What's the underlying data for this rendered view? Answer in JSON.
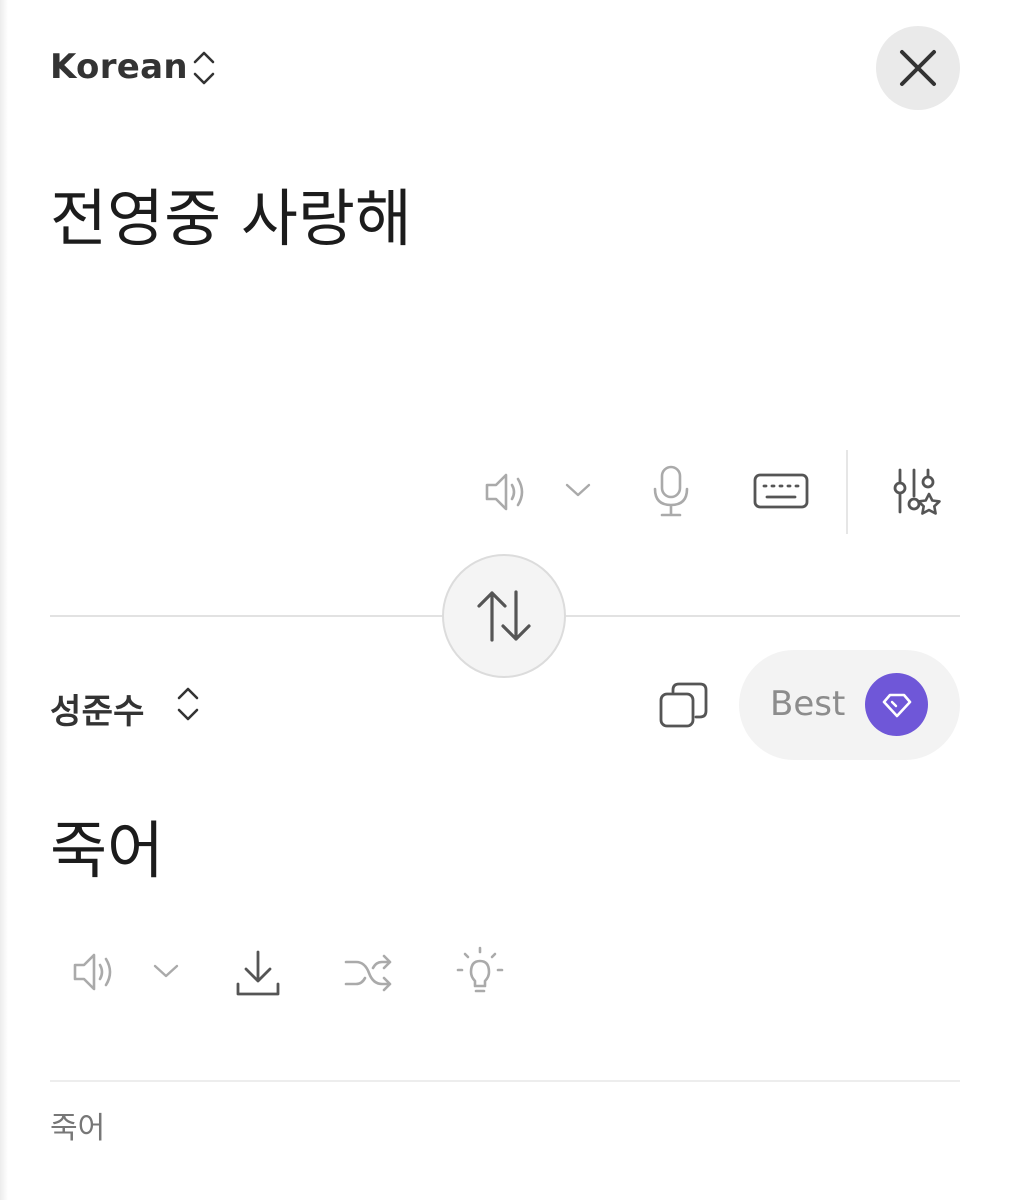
{
  "source": {
    "language": "Korean",
    "text": "전영중 사랑해"
  },
  "target": {
    "language": "성준수",
    "text": "죽어",
    "best_label": "Best"
  },
  "footer": {
    "text": "죽어"
  },
  "icons": {
    "close": "close-icon",
    "speaker": "speaker-icon",
    "chevron": "chevron-down-icon",
    "mic": "microphone-icon",
    "keyboard": "keyboard-icon",
    "settings": "sliders-star-icon",
    "swap": "swap-vertical-icon",
    "copy": "copy-icon",
    "gem": "gem-icon",
    "download": "download-icon",
    "shuffle": "shuffle-icon",
    "idea": "lightbulb-icon"
  },
  "colors": {
    "accent": "#6f57d8",
    "icon_dark": "#555555",
    "icon_light": "#a9a9a9"
  }
}
